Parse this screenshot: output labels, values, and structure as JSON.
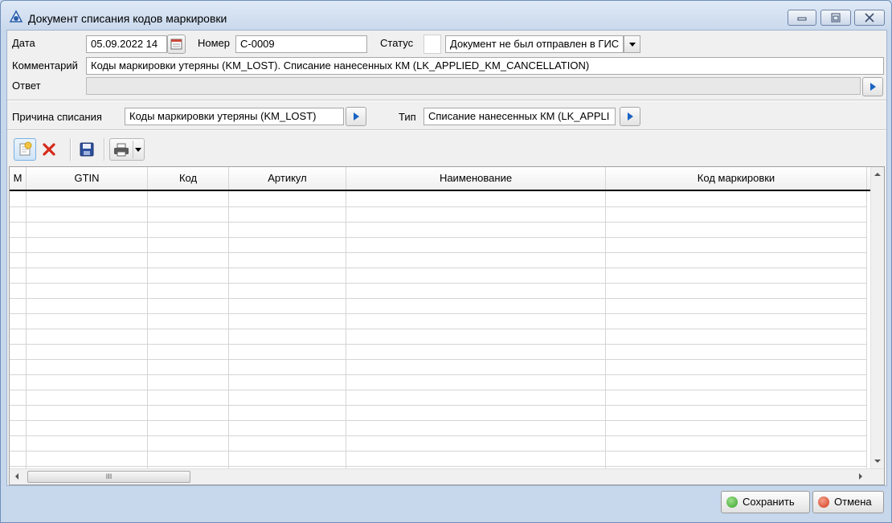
{
  "window": {
    "title": "Документ списания кодов маркировки",
    "controls": {
      "minimize": "▭",
      "maximize": "□",
      "close": "✕"
    }
  },
  "form": {
    "date_label": "Дата",
    "date_value": "05.09.2022 14",
    "number_label": "Номер",
    "number_value": "C-0009",
    "status_label": "Статус",
    "status_value": "Документ не был отправлен в ГИС",
    "comment_label": "Комментарий",
    "comment_value": "Коды маркировки утеряны (KM_LOST). Списание нанесенных КМ (LK_APPLIED_KM_CANCELLATION)",
    "answer_label": "Ответ",
    "answer_value": "",
    "reason_label": "Причина списания",
    "reason_value": "Коды маркировки утеряны (KM_LOST)",
    "type_label": "Тип",
    "type_value": "Списание нанесенных КМ (LK_APPLI"
  },
  "toolbar": {
    "icons": [
      "add-icon",
      "delete-icon",
      "save-icon",
      "print-icon"
    ]
  },
  "table": {
    "columns": [
      "М",
      "GTIN",
      "Код",
      "Артикул",
      "Наименование",
      "Код маркировки"
    ],
    "rows": [],
    "hscroll_grip": "III"
  },
  "footer": {
    "save_label": "Сохранить",
    "cancel_label": "Отмена"
  },
  "colors": {
    "accent_blue": "#1a63c4",
    "save_green": "#3aa22e",
    "cancel_red": "#d23a1e"
  }
}
